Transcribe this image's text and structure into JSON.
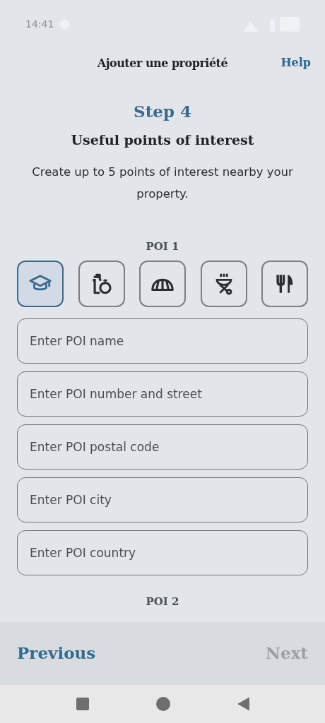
{
  "status_bar": {
    "time": "14:41"
  },
  "header": {
    "title": "Ajouter une propriété",
    "help": "Help"
  },
  "step": {
    "label": "Step 4",
    "title": "Useful points of interest",
    "description": "Create up to 5 points of interest nearby your property."
  },
  "poi_sections": [
    {
      "label": "POI 1",
      "categories": [
        {
          "kind": "school",
          "selected": true
        },
        {
          "kind": "groceries",
          "selected": false
        },
        {
          "kind": "bakery",
          "selected": false
        },
        {
          "kind": "grill",
          "selected": false
        },
        {
          "kind": "restaurant",
          "selected": false
        }
      ],
      "fields": [
        {
          "placeholder": "Enter POI name"
        },
        {
          "placeholder": "Enter POI number and street"
        },
        {
          "placeholder": "Enter POI postal code"
        },
        {
          "placeholder": "Enter POI city"
        },
        {
          "placeholder": "Enter POI country"
        }
      ]
    },
    {
      "label": "POI 2"
    }
  ],
  "footer": {
    "previous": {
      "label": "Previous",
      "disabled": false
    },
    "next": {
      "label": "Next",
      "disabled": true
    }
  }
}
